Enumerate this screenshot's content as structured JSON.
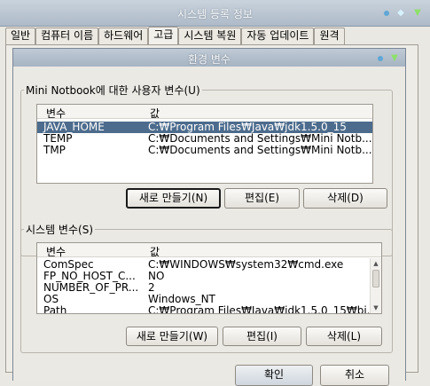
{
  "outer_window": {
    "title": "시스템 등록 정보",
    "tabs": [
      {
        "label": "일반"
      },
      {
        "label": "컴퓨터 이름"
      },
      {
        "label": "하드웨어"
      },
      {
        "label": "고급"
      },
      {
        "label": "시스템 복원"
      },
      {
        "label": "자동 업데이트"
      },
      {
        "label": "원격"
      }
    ]
  },
  "dialog": {
    "title": "환경 변수",
    "user_vars": {
      "label": "Mini Notbook에 대한 사용자 변수(U)",
      "col_variable": "변수",
      "col_value": "값",
      "rows": [
        {
          "name": "JAVA_HOME",
          "value": "C:₩Program Files₩Java₩jdk1.5.0_15"
        },
        {
          "name": "TEMP",
          "value": "C:₩Documents and Settings₩Mini Notb..."
        },
        {
          "name": "TMP",
          "value": "C:₩Documents and Settings₩Mini Notb..."
        }
      ],
      "new_button": "새로 만들기(N)",
      "edit_button": "편집(E)",
      "delete_button": "삭제(D)"
    },
    "system_vars": {
      "label": "시스템 변수(S)",
      "col_variable": "변수",
      "col_value": "값",
      "rows": [
        {
          "name": "ComSpec",
          "value": "C:₩WINDOWS₩system32₩cmd.exe"
        },
        {
          "name": "FP_NO_HOST_C...",
          "value": "NO"
        },
        {
          "name": "NUMBER_OF_PR...",
          "value": "2"
        },
        {
          "name": "OS",
          "value": "Windows_NT"
        },
        {
          "name": "Path",
          "value": "C:₩Program Files₩Java₩jdk1.5.0_15₩bi..."
        }
      ],
      "new_button": "새로 만들기(W)",
      "edit_button": "편집(I)",
      "delete_button": "삭제(L)"
    },
    "ok_button": "확인",
    "cancel_button": "취소"
  }
}
